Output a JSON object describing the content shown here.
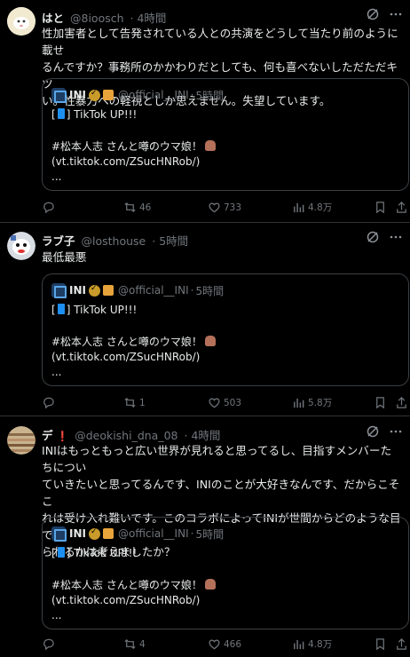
{
  "tweets": [
    {
      "name": "はと",
      "handle": "@8ioosch",
      "dot": "·",
      "time": "4時間",
      "text": [
        "性加害者として告発されている人との共演をどうして当たり前のように載せ",
        "るんですか？事務所のかかわりだとしても、何も喜べないしただただキツ",
        "い。性暴力への軽視としか思えません。失望しています。"
      ],
      "quote": {
        "name": "INI",
        "handle": "@official__INI",
        "dot": "·",
        "time": "5時間",
        "line1_pre": "[",
        "line1_post": "] TikTok UP!!!",
        "line2": "#松本人志 さんと噂のウマ娘！",
        "line3": "(vt.tiktok.com/ZSucHNRob/)",
        "line4": "..."
      },
      "replies": "",
      "retweets": "46",
      "likes": "733",
      "views": "4.8万"
    },
    {
      "name": "ラブ子",
      "handle": "@losthouse",
      "dot": "·",
      "time": "5時間",
      "text": [
        "最低最悪"
      ],
      "quote": {
        "name": "INI",
        "handle": "@official__INI",
        "dot": "·",
        "time": "5時間",
        "line1_pre": "[",
        "line1_post": "] TikTok UP!!!",
        "line2": "#松本人志 さんと噂のウマ娘！",
        "line3": "(vt.tiktok.com/ZSucHNRob/)",
        "line4": "..."
      },
      "replies": "",
      "retweets": "1",
      "likes": "503",
      "views": "5.8万"
    },
    {
      "name": "デ",
      "name_mark": "❗",
      "handle": "@deokishi_dna_08",
      "dot": "·",
      "time": "4時間",
      "text": [
        "INIはもっともっと広い世界が見れると思ってるし、目指すメンバーたちについ",
        "ていきたいと思ってるんです、INIのことが大好きなんです、だからこそこ",
        "れは受け入れ難いです。このコラボによってINIが世間からどのような目で見",
        "られるかは考えましたか？"
      ],
      "quote": {
        "name": "INI",
        "handle": "@official__INI",
        "dot": "·",
        "time": "5時間",
        "line1_pre": "[",
        "line1_post": "] TikTok UP!!!",
        "line2": "#松本人志 さんと噂のウマ娘！",
        "line3": "(vt.tiktok.com/ZSucHNRob/)",
        "line4": "..."
      },
      "replies": "",
      "retweets": "4",
      "likes": "466",
      "views": "4.8万"
    }
  ],
  "colors": {
    "background": "#000000",
    "text": "#e7e9ea",
    "muted": "#71767b",
    "border": "#2f3336"
  },
  "icons": [
    "reply-icon",
    "retweet-icon",
    "like-icon",
    "views-icon",
    "bookmark-icon",
    "share-icon",
    "grok-icon",
    "more-icon"
  ]
}
